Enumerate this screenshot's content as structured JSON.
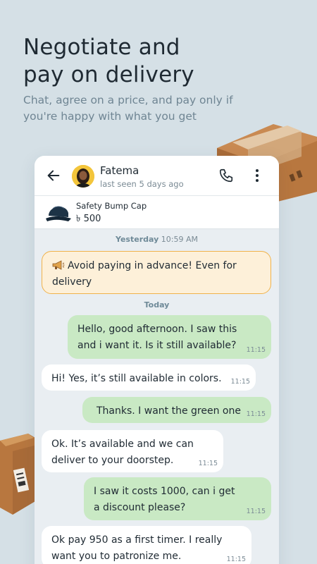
{
  "promo": {
    "headline_line1": "Negotiate and",
    "headline_line2": "pay on delivery",
    "subline_line1": "Chat, agree on a price, and pay only if",
    "subline_line2": "you're happy with what you get"
  },
  "colors": {
    "background": "#d5e0e6",
    "outgoing_bubble": "#c9e9c4",
    "incoming_bubble": "#ffffff",
    "warning_bg": "#fdf0d9",
    "warning_border": "#f0b24a"
  },
  "chat_header": {
    "back_icon": "arrow-left-icon",
    "contact_name": "Fatema",
    "last_seen": "last seen 5 days ago",
    "call_icon": "phone-icon",
    "menu_icon": "more-vertical-icon"
  },
  "product": {
    "name": "Safety Bump Cap",
    "price": "৳ 500"
  },
  "separators": {
    "yesterday_label": "Yesterday",
    "yesterday_time": "10:59 AM",
    "today_label": "Today"
  },
  "warning": {
    "icon": "megaphone-icon",
    "line1": "Avoid paying in advance! Even for",
    "line2": "delivery"
  },
  "messages": [
    {
      "dir": "out",
      "line1": "Hello, good afternoon. I saw this",
      "line2": "and i want it. Is it still available?",
      "time": "11:15"
    },
    {
      "dir": "in",
      "line1": "Hi! Yes, it’s still available in colors.",
      "line2": "",
      "time": "11:15"
    },
    {
      "dir": "out",
      "line1": "Thanks. I want the green one",
      "line2": "",
      "time": "11:15"
    },
    {
      "dir": "in",
      "line1": "Ok. It’s available and we can",
      "line2": "deliver to your doorstep.",
      "time": "11:15"
    },
    {
      "dir": "out",
      "line1": "I saw it costs 1000, can i get",
      "line2": "a discount please?",
      "time": "11:15"
    },
    {
      "dir": "in",
      "line1": "Ok pay 950 as a first timer. I really",
      "line2": "want you to patronize me.",
      "time": "11:15"
    }
  ]
}
